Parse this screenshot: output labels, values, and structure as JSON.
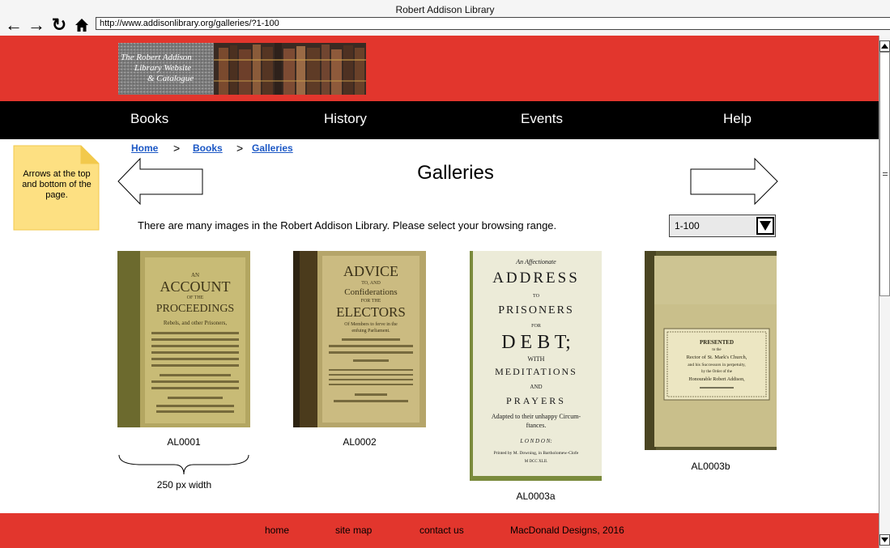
{
  "window": {
    "title": "Robert Addison Library"
  },
  "browser": {
    "url": "http://www.addisonlibrary.org/galleries/?1-100",
    "back_icon": "arrow-left-icon",
    "forward_icon": "arrow-right-icon",
    "reload_icon": "reload-icon",
    "home_icon": "home-icon"
  },
  "header": {
    "logo_text": [
      "The Robert Addison",
      "Library Website",
      "& Catalogue"
    ]
  },
  "nav": {
    "items": [
      "Books",
      "History",
      "Events",
      "Help"
    ]
  },
  "breadcrumb": {
    "items": [
      "Home",
      "Books",
      "Galleries"
    ],
    "separator": ">"
  },
  "page": {
    "title": "Galleries",
    "intro": "There are many images in the Robert Addison Library. Please select your browsing range.",
    "range_selected": "1-100"
  },
  "note": {
    "text": "Arrows at the top and bottom of the page."
  },
  "annotation": {
    "width_label": "250 px width"
  },
  "gallery": [
    {
      "caption": "AL0001",
      "lines": [
        "AN",
        "ACCOUNT",
        "OF THE",
        "PROCEEDINGS",
        "Rebels, and other Prisoners,"
      ]
    },
    {
      "caption": "AL0002",
      "lines": [
        "ADVICE",
        "TO, AND",
        "Confiderations",
        "FOR THE",
        "ELECTORS",
        "Of Members to ferve in the",
        "enfuing Parliament."
      ]
    },
    {
      "caption": "AL0003a",
      "lines": [
        "An Affectionate",
        "ADDRESS",
        "TO",
        "PRISONERS",
        "FOR",
        "D E B T;",
        "WITH",
        "MEDITATIONS",
        "AND",
        "PRAYERS",
        "Adapted to their unhappy Circum-",
        "ftances.",
        "L O N D O N:",
        "Printed by M. Downing, in Bartholomew-Clofe",
        "M DCC XLII."
      ]
    },
    {
      "caption": "AL0003b",
      "lines": [
        "PRESENTED",
        "to the",
        "Rector of St. Mark's Church,",
        "and his Successors in perpetuity,",
        "by the Order of the",
        "Honourable Robert Addison,"
      ]
    }
  ],
  "footer": {
    "links": [
      "home",
      "site map",
      "contact us"
    ],
    "copyright": "MacDonald Designs, 2016"
  },
  "colors": {
    "brand_red": "#e2362d",
    "nav_black": "#000000",
    "link_blue": "#1b57c5",
    "note_yellow": "#fde082"
  }
}
